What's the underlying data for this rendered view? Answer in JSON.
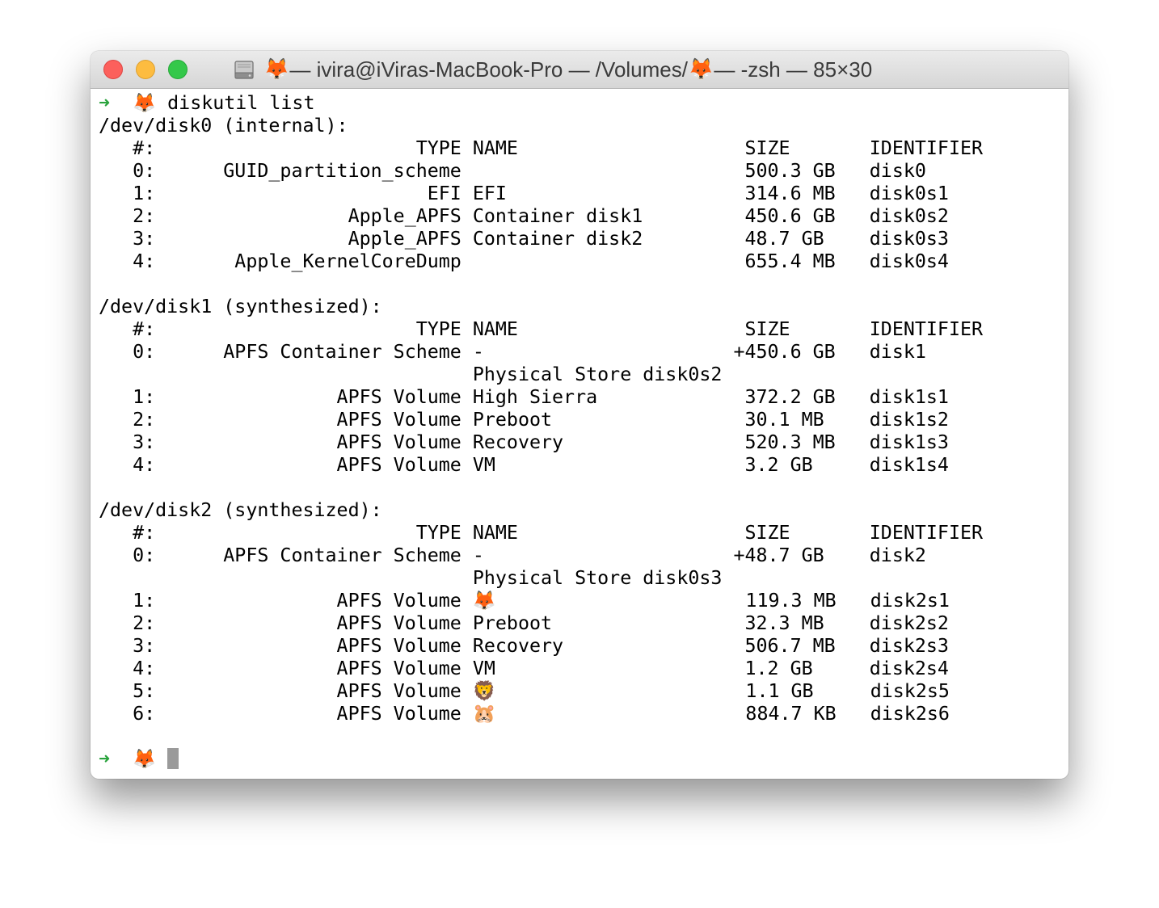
{
  "window": {
    "title_segments": [
      "🦊",
      " — ivira@iViras-MacBook-Pro — /Volumes/",
      "🦊",
      " — -zsh — 85×30"
    ]
  },
  "terminal": {
    "command_prompt": {
      "arrow": "➜",
      "symbol": "🦊",
      "command": "diskutil list"
    },
    "output_lines": [
      "/dev/disk0 (internal):",
      "   #:                       TYPE NAME                    SIZE       IDENTIFIER",
      "   0:      GUID_partition_scheme                         500.3 GB   disk0",
      "   1:                        EFI EFI                     314.6 MB   disk0s1",
      "   2:                 Apple_APFS Container disk1         450.6 GB   disk0s2",
      "   3:                 Apple_APFS Container disk2         48.7 GB    disk0s3",
      "   4:       Apple_KernelCoreDump                         655.4 MB   disk0s4",
      "",
      "/dev/disk1 (synthesized):",
      "   #:                       TYPE NAME                    SIZE       IDENTIFIER",
      "   0:      APFS Container Scheme -                      +450.6 GB   disk1",
      "                                 Physical Store disk0s2",
      "   1:                APFS Volume High Sierra             372.2 GB   disk1s1",
      "   2:                APFS Volume Preboot                 30.1 MB    disk1s2",
      "   3:                APFS Volume Recovery                520.3 MB   disk1s3",
      "   4:                APFS Volume VM                      3.2 GB     disk1s4",
      "",
      "/dev/disk2 (synthesized):",
      "   #:                       TYPE NAME                    SIZE       IDENTIFIER",
      "   0:      APFS Container Scheme -                      +48.7 GB    disk2",
      "                                 Physical Store disk0s3",
      "   1:                APFS Volume 🦊                      119.3 MB   disk2s1",
      "   2:                APFS Volume Preboot                 32.3 MB    disk2s2",
      "   3:                APFS Volume Recovery                506.7 MB   disk2s3",
      "   4:                APFS Volume VM                      1.2 GB     disk2s4",
      "   5:                APFS Volume 🦁                      1.1 GB     disk2s5",
      "   6:                APFS Volume 🐹                      884.7 KB   disk2s6",
      ""
    ],
    "final_prompt": {
      "arrow": "➜",
      "symbol": "🦊"
    }
  }
}
